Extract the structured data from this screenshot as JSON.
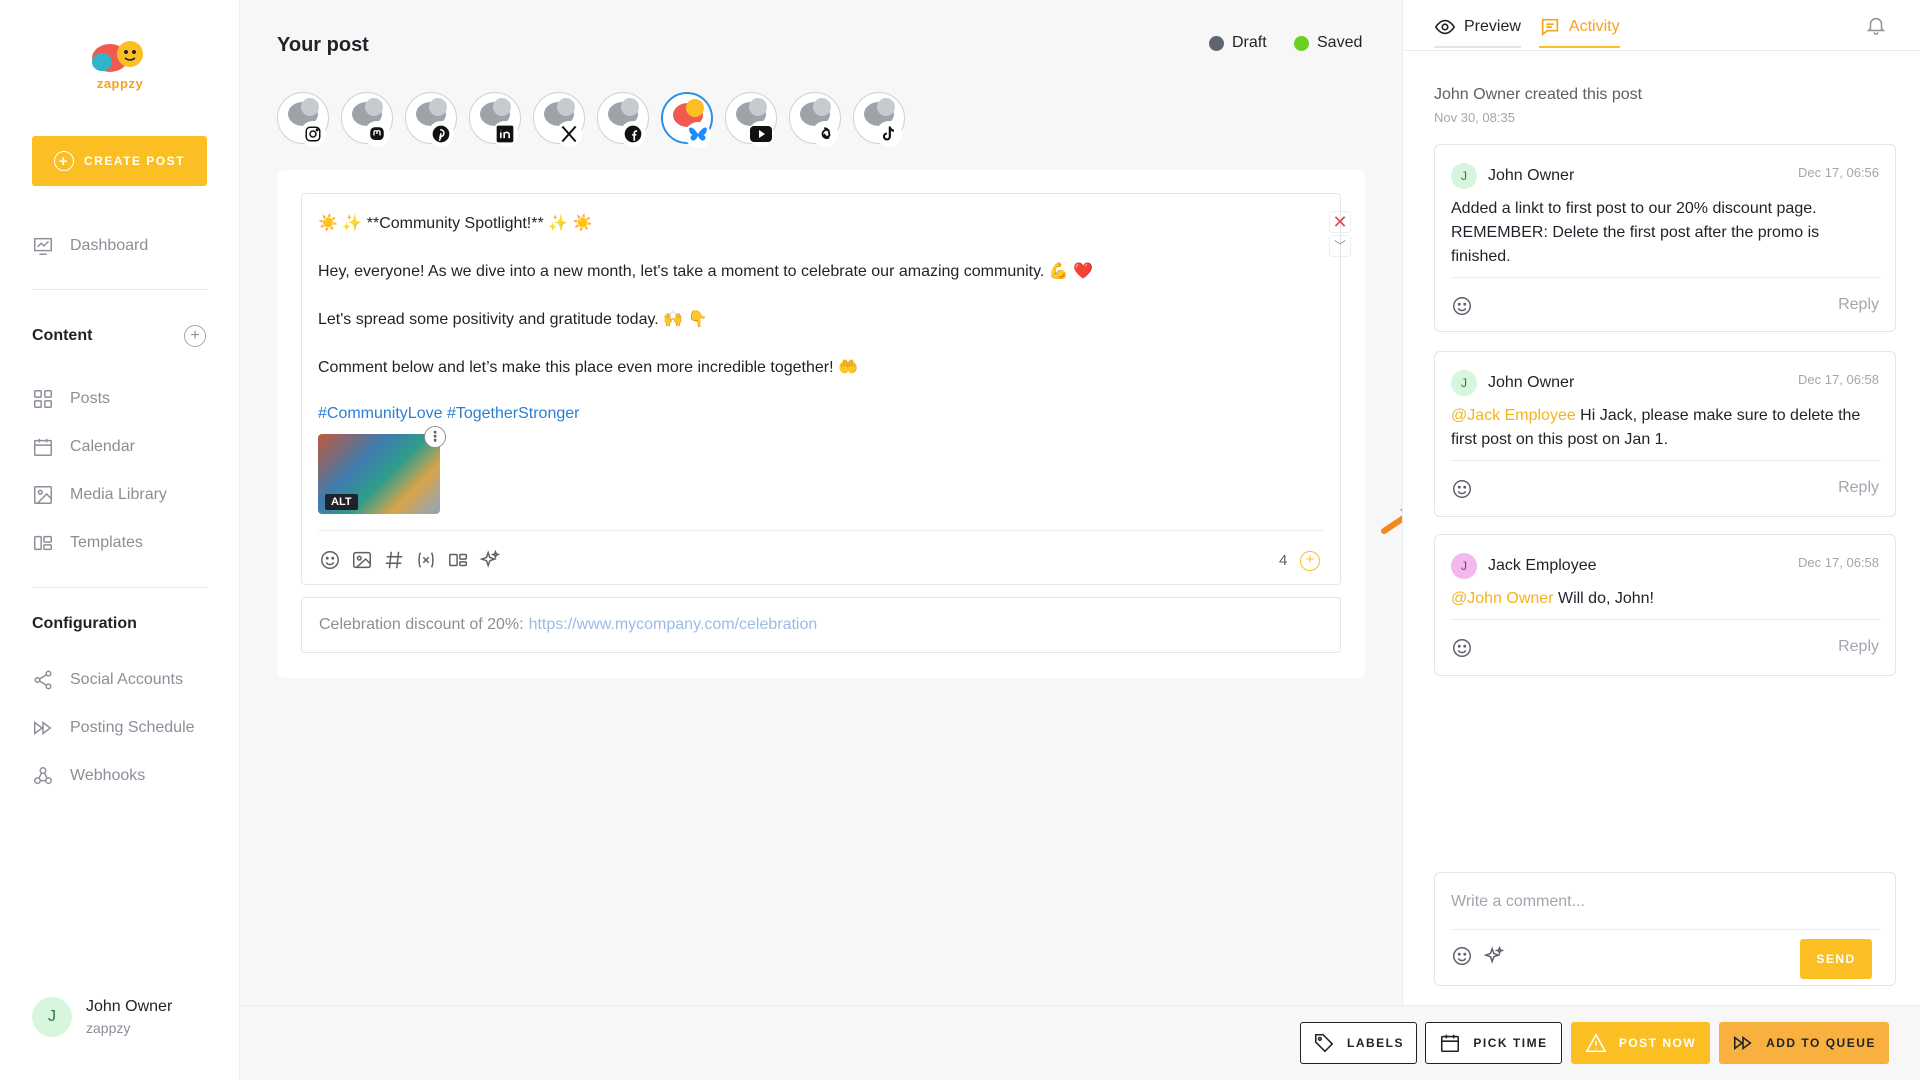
{
  "sidebar": {
    "logo_text": "zappzy",
    "create_post_label": "CREATE POST",
    "dashboard_label": "Dashboard",
    "content_title": "Content",
    "content_items": [
      "Posts",
      "Calendar",
      "Media Library",
      "Templates"
    ],
    "configuration_title": "Configuration",
    "config_items": [
      "Social Accounts",
      "Posting Schedule",
      "Webhooks"
    ],
    "user": {
      "initial": "J",
      "name": "John Owner",
      "org": "zappzy"
    }
  },
  "main": {
    "title": "Your post",
    "status_draft": "Draft",
    "status_saved": "Saved",
    "channels": [
      "instagram",
      "mastodon",
      "pinterest",
      "linkedin",
      "x",
      "facebook",
      "bluesky",
      "youtube",
      "threads",
      "tiktok"
    ],
    "active_channel": "bluesky",
    "post": {
      "line1": "☀️ ✨ **Community Spotlight!** ✨ ☀️",
      "line2": "Hey, everyone! As we dive into a new month, let's take a moment to celebrate our amazing community. 💪 ❤️",
      "line3": "Let's spread some positivity and gratitude today. 🙌 👇",
      "line4": "Comment below and let’s make this place even more incredible together! 🤲",
      "hashtags": "#CommunityLove #TogetherStronger",
      "image_alt_tag": "ALT"
    },
    "count": "4",
    "first_comment_text": "Celebration discount of 20%:",
    "first_comment_url": "https://www.mycompany.com/celebration"
  },
  "right_panel": {
    "tab_preview": "Preview",
    "tab_activity": "Activity",
    "created_text": "John Owner created this post",
    "created_time": "Nov 30, 08:35",
    "comments": [
      {
        "initial": "J",
        "author": "John Owner",
        "time": "Dec 17, 06:56",
        "mention": "",
        "text": "Added a linkt to first post to our 20% discount page. REMEMBER: Delete the first post after the promo is finished.",
        "reply": "Reply"
      },
      {
        "initial": "J",
        "author": "John Owner",
        "time": "Dec 17, 06:58",
        "mention": "@Jack Employee",
        "text": " Hi Jack, please make sure to delete the first post on this post on Jan 1.",
        "reply": "Reply"
      },
      {
        "initial": "J",
        "author": "Jack Employee",
        "time": "Dec 17, 06:58",
        "mention": "@John Owner",
        "text": " Will do, John!",
        "reply": "Reply"
      }
    ],
    "compose_placeholder": "Write a comment...",
    "send_label": "SEND"
  },
  "bottom_bar": {
    "labels": "LABELS",
    "pick_time": "PICK TIME",
    "post_now": "POST NOW",
    "add_to_queue": "ADD TO QUEUE"
  },
  "colors": {
    "accent": "#fbbf24",
    "draft_dot": "#5f6672",
    "saved_dot": "#6ccf1e",
    "link": "#2b7fd4",
    "mention": "#f4b41a"
  }
}
